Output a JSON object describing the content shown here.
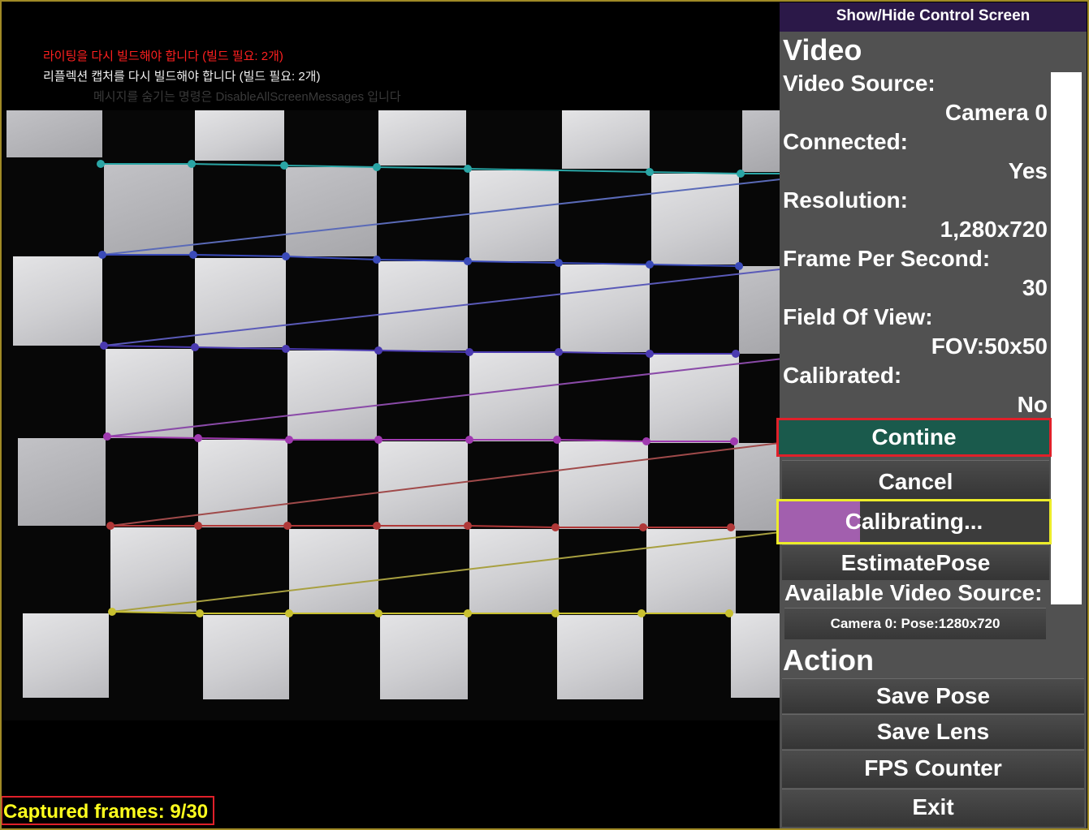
{
  "messages": {
    "rebuild_lighting": "라이팅을 다시 빌드해야 합니다 (빌드 필요: 2개)",
    "rebuild_reflection": "리플렉션 캡처를 다시 빌드해야 합니다 (빌드 필요: 2개)",
    "hide_messages": "메시지를 숨기는 명령은 DisableAllScreenMessages 입니다"
  },
  "captured_frames": "Captured frames: 9/30",
  "panel": {
    "toggle_label": "Show/Hide Control Screen",
    "video_heading": "Video",
    "fields": [
      {
        "label": "Video Source:",
        "value": "Camera 0"
      },
      {
        "label": "Connected:",
        "value": "Yes"
      },
      {
        "label": "Resolution:",
        "value": "1,280x720"
      },
      {
        "label": "Frame Per Second:",
        "value": "30"
      },
      {
        "label": "Field Of View:",
        "value": "FOV:50x50"
      },
      {
        "label": "Calibrated:",
        "value": "No"
      }
    ],
    "contine_label": "Contine",
    "cancel_label": "Cancel",
    "calibrating_label": "Calibrating...",
    "calibration_progress": 0.3,
    "estimate_pose_label": "EstimatePose",
    "available_label": "Available Video Source:",
    "source_option": "Camera 0: Pose:1280x720",
    "action_heading": "Action",
    "actions": [
      "Save Pose",
      "Save Lens",
      "FPS Counter",
      "Exit"
    ]
  },
  "colors": {
    "contine_bg": "#1a5a4c",
    "progress_fill": "#a25fae",
    "captured_text": "#ffff1e",
    "highlight_red": "#e0202a",
    "highlight_yellow": "#ecec2a"
  }
}
